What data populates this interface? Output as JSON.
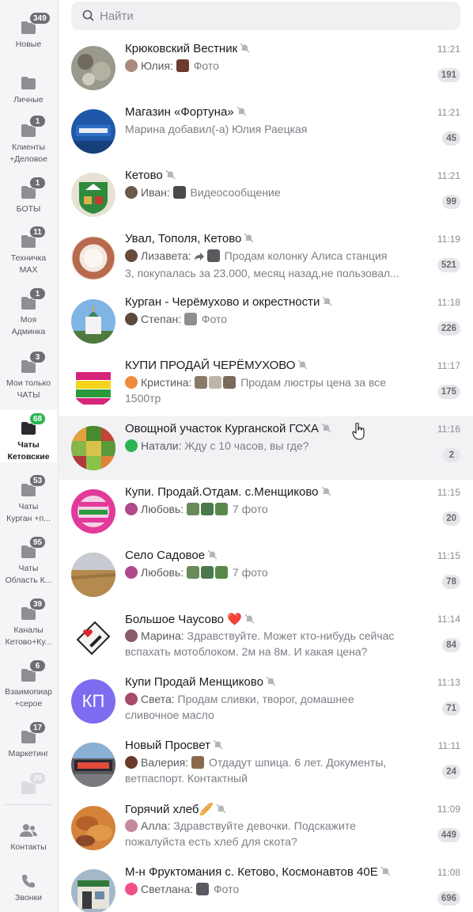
{
  "search": {
    "placeholder": "Найти"
  },
  "sidebar": {
    "folders": [
      {
        "label": "Новые",
        "badge": "349"
      },
      {
        "label": "Личные",
        "badge": ""
      },
      {
        "label": "Клиенты\n+Деловое",
        "badge": "1"
      },
      {
        "label": "БОТЫ",
        "badge": "1"
      },
      {
        "label": "Техничка\nMAX",
        "badge": "11"
      },
      {
        "label": "Моя\nАдминка",
        "badge": "1"
      },
      {
        "label": "Мои только\nЧАТЫ",
        "badge": "3"
      },
      {
        "label": "Чаты\nКетовские",
        "badge": "68"
      },
      {
        "label": "Чаты\nКурган +п...",
        "badge": "53"
      },
      {
        "label": "Чаты\nОбласть К...",
        "badge": "95"
      },
      {
        "label": "Каналы\nКетово+Ку...",
        "badge": "39"
      },
      {
        "label": "Взаимопиар\n+серое",
        "badge": "6"
      },
      {
        "label": "Маркетинг",
        "badge": "17"
      },
      {
        "label": "",
        "badge": "26"
      }
    ],
    "bottom": [
      {
        "label": "Контакты"
      },
      {
        "label": "Звонки"
      }
    ]
  },
  "chats": [
    {
      "title": "Крюковский Вестник",
      "time": "11:21",
      "count": "191",
      "sender": "Юлия:",
      "msg1": "Фото",
      "msg2": ""
    },
    {
      "title": "Магазин «Фортуна»",
      "time": "11:21",
      "count": "45",
      "sender": "",
      "msg1": "Марина добавил(-а) Юлия Раецкая",
      "msg2": ""
    },
    {
      "title": "Кетово",
      "time": "11:21",
      "count": "99",
      "sender": "Иван:",
      "msg1": "Видеосообщение",
      "msg2": ""
    },
    {
      "title": "Увал, Тополя, Кетово",
      "time": "11:19",
      "count": "521",
      "sender": "Лизавета:",
      "msg1": "Продам колонку Алиса станция",
      "msg2": "3, покупалась за 23.000, месяц назад,не пользовал..."
    },
    {
      "title": "Курган - Черёмухово и окрестности",
      "time": "11:18",
      "count": "226",
      "sender": "Степан:",
      "msg1": "Фото",
      "msg2": ""
    },
    {
      "title": "КУПИ ПРОДАЙ ЧЕРЁМУХОВО",
      "time": "11:17",
      "count": "175",
      "sender": "Кристина:",
      "msg1": "Продам люстры цена за все",
      "msg2": "1500тр"
    },
    {
      "title": "Овощной участок Курганской ГСХА",
      "time": "11:16",
      "count": "2",
      "sender": "Натали:",
      "msg1": "Жду с 10 часов, вы где?",
      "msg2": ""
    },
    {
      "title": "Купи. Продай.Отдам. с.Менщиково",
      "time": "11:15",
      "count": "20",
      "sender": "Любовь:",
      "msg1": "7 фото",
      "msg2": ""
    },
    {
      "title": "Село Садовое",
      "time": "11:15",
      "count": "78",
      "sender": "Любовь:",
      "msg1": "7 фото",
      "msg2": ""
    },
    {
      "title": "Большое Чаусово ❤️",
      "time": "11:14",
      "count": "84",
      "sender": "Марина:",
      "msg1": "Здравствуйте. Может кто-нибудь сейчас",
      "msg2": "вспахать мотоблоком. 2м на 8м. И какая цена?"
    },
    {
      "title": "Купи Продай Менщиково",
      "time": "11:13",
      "count": "71",
      "sender": "Света:",
      "msg1": "Продам сливки, творог, домашнее",
      "msg2": "сливочное масло"
    },
    {
      "title": "Новый Просвет",
      "time": "11:11",
      "count": "24",
      "sender": "Валерия:",
      "msg1": "Отдадут шпица. 6 лет. Документы,",
      "msg2": "ветпаспорт. Контактный"
    },
    {
      "title": "Горячий хлеб🥖",
      "time": "11:09",
      "count": "449",
      "sender": "Алла:",
      "msg1": "Здравствуйте девочки. Подскажите",
      "msg2": "пожалуйста есть хлеб для скота?"
    },
    {
      "title": "М-н Фруктомания с. Кетово, Космонавтов 40Е",
      "time": "11:08",
      "count": "696",
      "sender": "Светлана:",
      "msg1": "Фото",
      "msg2": ""
    }
  ],
  "avatar_text": {
    "kp": "КП"
  },
  "colors": {
    "active_badge": "#2bb552",
    "badge": "#6e6e76",
    "kp_avatar": "#7d6cf0"
  }
}
